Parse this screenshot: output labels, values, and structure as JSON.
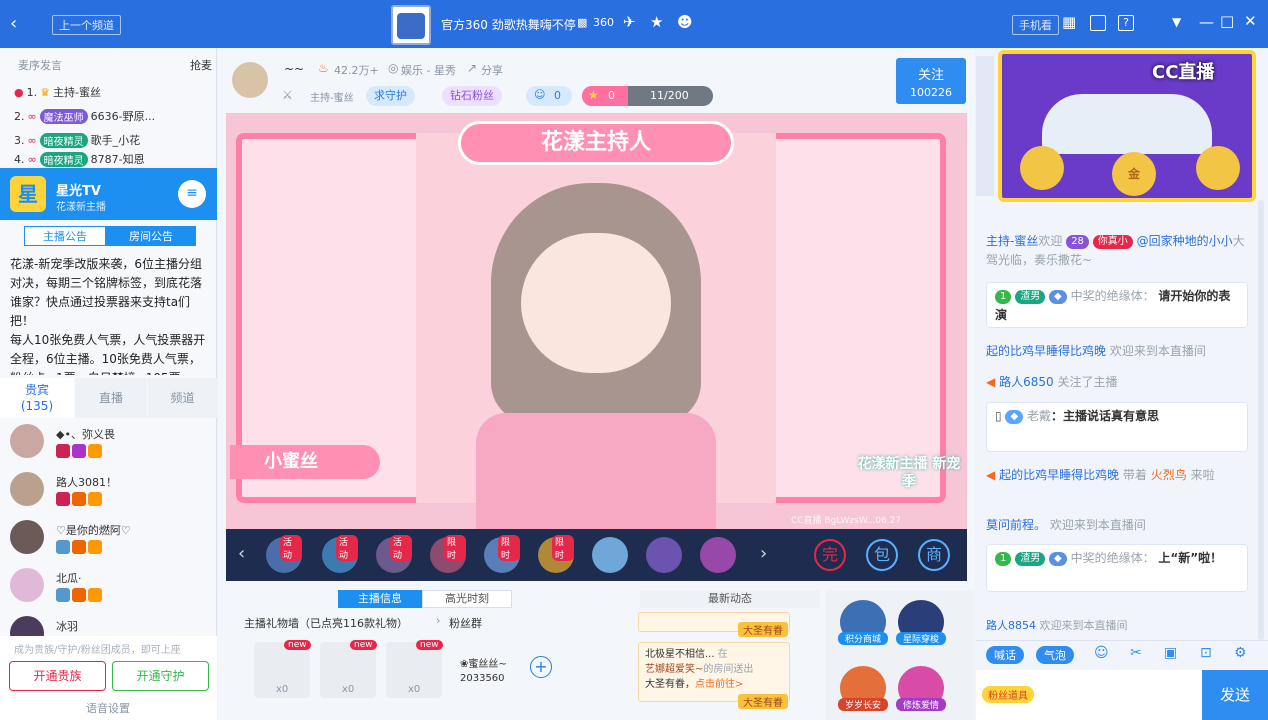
{
  "topbar": {
    "prev_channel": "上一个频道",
    "room_title": "官方360 劲歌热舞嗨不停",
    "room_id": "360",
    "phone_view": "手机看"
  },
  "left": {
    "ranks_header": "麦序发言",
    "grab_mic": "抢麦",
    "ranks": [
      {
        "num": "1.",
        "name": "主持-蜜丝"
      },
      {
        "num": "2.",
        "tag": "魔法巫师",
        "name": "6636-野原..."
      },
      {
        "num": "3.",
        "tag": "暗夜精灵",
        "name": "歌手_小花"
      },
      {
        "num": "4.",
        "tag": "暗夜精灵",
        "name": "8787-知恩"
      }
    ],
    "banner_title": "星光TV",
    "banner_sub": "花漾新主播",
    "tab_host": "主播公告",
    "tab_room": "房间公告",
    "notice": "花漾-新宠季改版来袭，6位主播分组对决，每期三个铭牌标签，到底花落谁家？快点通过投票器来支持ta们把！\n每人10张免费人气票，人气投票器开全程，6位主播。10张免费人气票，粉丝卡=1票、白日梦境=105票",
    "tab_vip": "贵宾",
    "vip_count": "(135)",
    "tab_live": "直播",
    "tab_channel": "频道",
    "users": [
      "◆•、弥义畏",
      "路人3081！",
      "♡是你的燃阿♡",
      "北瓜·",
      "冰羽"
    ],
    "join_hint": "成为贵族/守护/粉丝团成员，即可上座",
    "btn_noble": "开通贵族",
    "btn_guard": "开通守护",
    "voice_settings": "语音设置"
  },
  "anchor": {
    "name": "~~",
    "heat": "42.2万+",
    "category": "娱乐 - 星秀",
    "share": "分享",
    "host_label": "主持-蜜丝",
    "guard_btn": "求守护",
    "fans_btn": "钻石粉丝",
    "fans_count": "0",
    "task_count": "0",
    "progress_text": "11/200",
    "progress": 0.055,
    "follow": "关注",
    "followers": "100226"
  },
  "video": {
    "title_banner": "花漾主持人",
    "name_plate": "小蜜丝",
    "corner_logo": "花漾新主播 新宠季",
    "watermark": "CC直播 BgLWzsW...06.27"
  },
  "gifts": {
    "tags": [
      "活动",
      "活动",
      "活动",
      "限时",
      "限时",
      "限时"
    ]
  },
  "info": {
    "tab_info": "主播信息",
    "tab_highlight": "高光时刻",
    "gift_wall": "主播礼物墙（已点亮116款礼物）",
    "fan_group": "粉丝群",
    "new_label": "new",
    "gift_counts": [
      "x0",
      "x0",
      "x0"
    ],
    "fan_name": "❀蜜丝丝~",
    "fan_id": "2033560",
    "news_header": "最新动态",
    "news_text1": "北极星不相信...",
    "news_text2": "在",
    "news_text3": "艺娜超爱笑~",
    "news_text4": "的房间送出",
    "news_text5": "大圣有眷，",
    "news_link": "点击前往>",
    "news_badge": "大圣有眷"
  },
  "activities": [
    "积分商城",
    "星际穿梭",
    "岁岁长安",
    "修炼爱情"
  ],
  "right": {
    "banner_brand": "CC直播",
    "chat": [
      {
        "user": "主持-蜜丝",
        "pre": "欢迎",
        "tag": "你真小",
        "name": "@回家种地的小小",
        "post": "大驾光临，奏乐撒花~"
      },
      {
        "level": "1",
        "tag": "渣男",
        "name": "中奖的绝缘体：",
        "text": "请开始你的表演"
      },
      {
        "user": "起的比鸡早睡得比鸡晚",
        "text": "欢迎来到本直播间"
      },
      {
        "user": "路人6850",
        "text": "关注了主播"
      },
      {
        "name": "老戴",
        "text": "：主播说话真有意思"
      },
      {
        "user": "起的比鸡早睡得比鸡晚",
        "pre": "带着",
        "gift": "火烈鸟",
        "post": "来啦"
      },
      {
        "user": "莫问前程。",
        "text": "欢迎来到本直播间"
      },
      {
        "level": "1",
        "tag": "渣男",
        "name": "中奖的绝缘体：",
        "text": "上“新”啦！"
      },
      {
        "user": "路人8854",
        "text": "欢迎来到本直播间"
      }
    ],
    "tool_say": "喊话",
    "tool_bubble": "气泡",
    "fan_badge": "粉丝道具",
    "send": "发送"
  }
}
